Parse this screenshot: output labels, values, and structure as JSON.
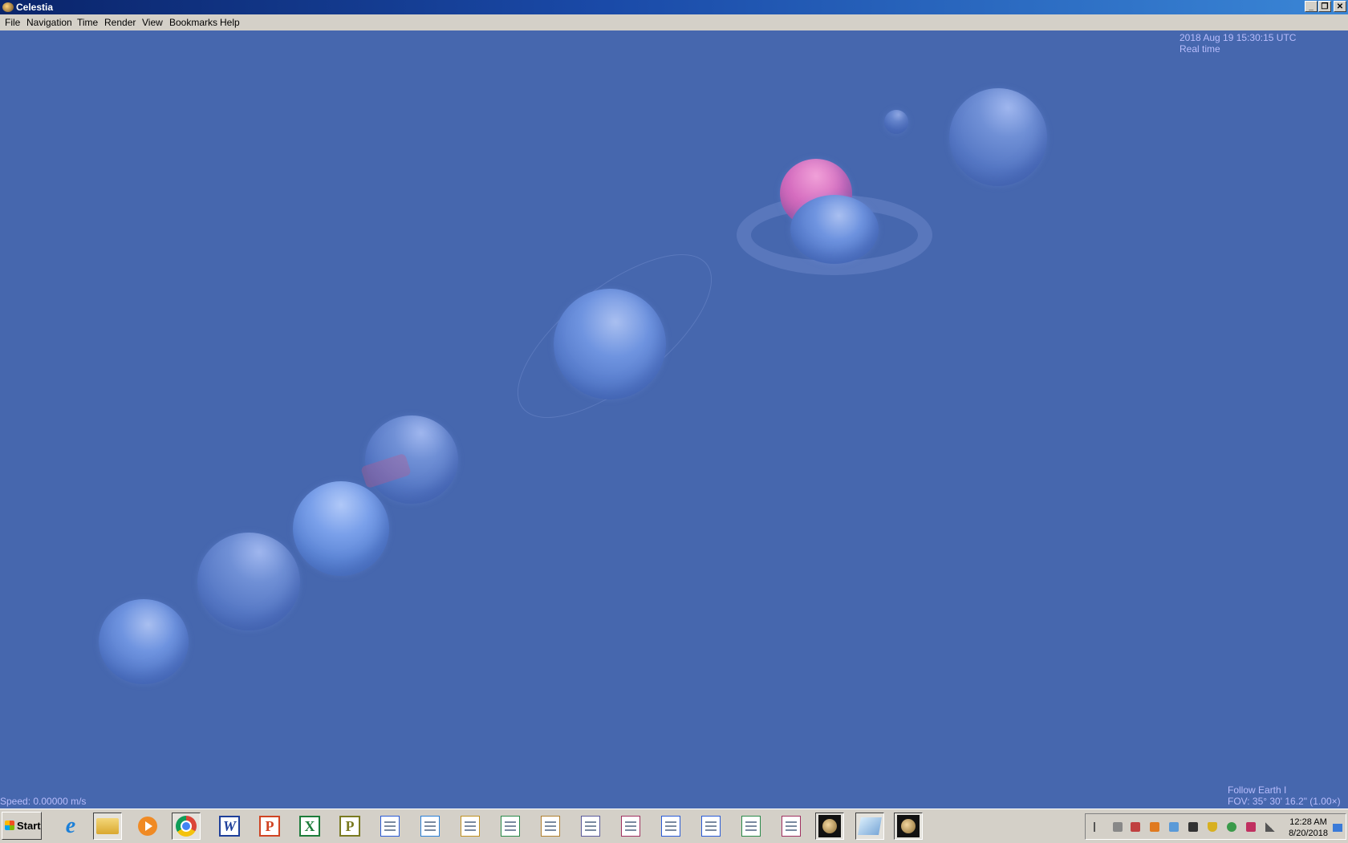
{
  "window": {
    "title": "Celestia",
    "minimize": "_",
    "maximize": "❐",
    "close": "✕"
  },
  "menu": [
    {
      "label": "File"
    },
    {
      "label": "Navigation"
    },
    {
      "label": "Time"
    },
    {
      "label": "Render"
    },
    {
      "label": "View"
    },
    {
      "label": "Bookmarks"
    },
    {
      "label": "Help"
    }
  ],
  "hud": {
    "datetime": "2018 Aug 19 15:30:15 UTC",
    "time_mode": "Real time",
    "speed": "Speed: 0.00000 m/s",
    "follow": "Follow Earth I",
    "fov": "FOV: 35° 30' 16.2\" (1.00×)"
  },
  "taskbar": {
    "start_label": "Start",
    "apps": [
      {
        "name": "internet-explorer-icon",
        "color": "#1b7fd8"
      },
      {
        "name": "file-explorer-icon",
        "color": "#e8c04a"
      },
      {
        "name": "media-player-icon",
        "color": "#f08a24"
      },
      {
        "name": "chrome-icon",
        "color": "#dd4b39"
      },
      {
        "name": "word-icon",
        "color": "#1e3f9a"
      },
      {
        "name": "powerpoint-icon",
        "color": "#d04423"
      },
      {
        "name": "excel-icon",
        "color": "#1d7c3a"
      },
      {
        "name": "publisher-icon",
        "color": "#7a7a20"
      },
      {
        "name": "word-document-icon",
        "color": "#2a5bd7"
      },
      {
        "name": "network-document-icon",
        "color": "#2a7fd7"
      },
      {
        "name": "user-document-icon",
        "color": "#c09020"
      },
      {
        "name": "excel-document-icon",
        "color": "#2a8a4a"
      },
      {
        "name": "mail-document-icon",
        "color": "#b08030"
      },
      {
        "name": "chart-document-icon",
        "color": "#5a5a9a"
      },
      {
        "name": "paint-document-icon",
        "color": "#a03060"
      },
      {
        "name": "word-doc-2-icon",
        "color": "#2a5bd7"
      },
      {
        "name": "table-document-icon",
        "color": "#2a5bd7"
      },
      {
        "name": "excel-doc-2-icon",
        "color": "#2a8a4a"
      },
      {
        "name": "image-document-icon",
        "color": "#a03060"
      },
      {
        "name": "celestia-icon",
        "color": "#8a6a30"
      },
      {
        "name": "notebook-icon",
        "color": "#7aa8d8"
      },
      {
        "name": "celestia-active-icon",
        "color": "#8a6a30"
      }
    ],
    "clock_time": "12:28 AM",
    "clock_date": "8/20/2018"
  }
}
